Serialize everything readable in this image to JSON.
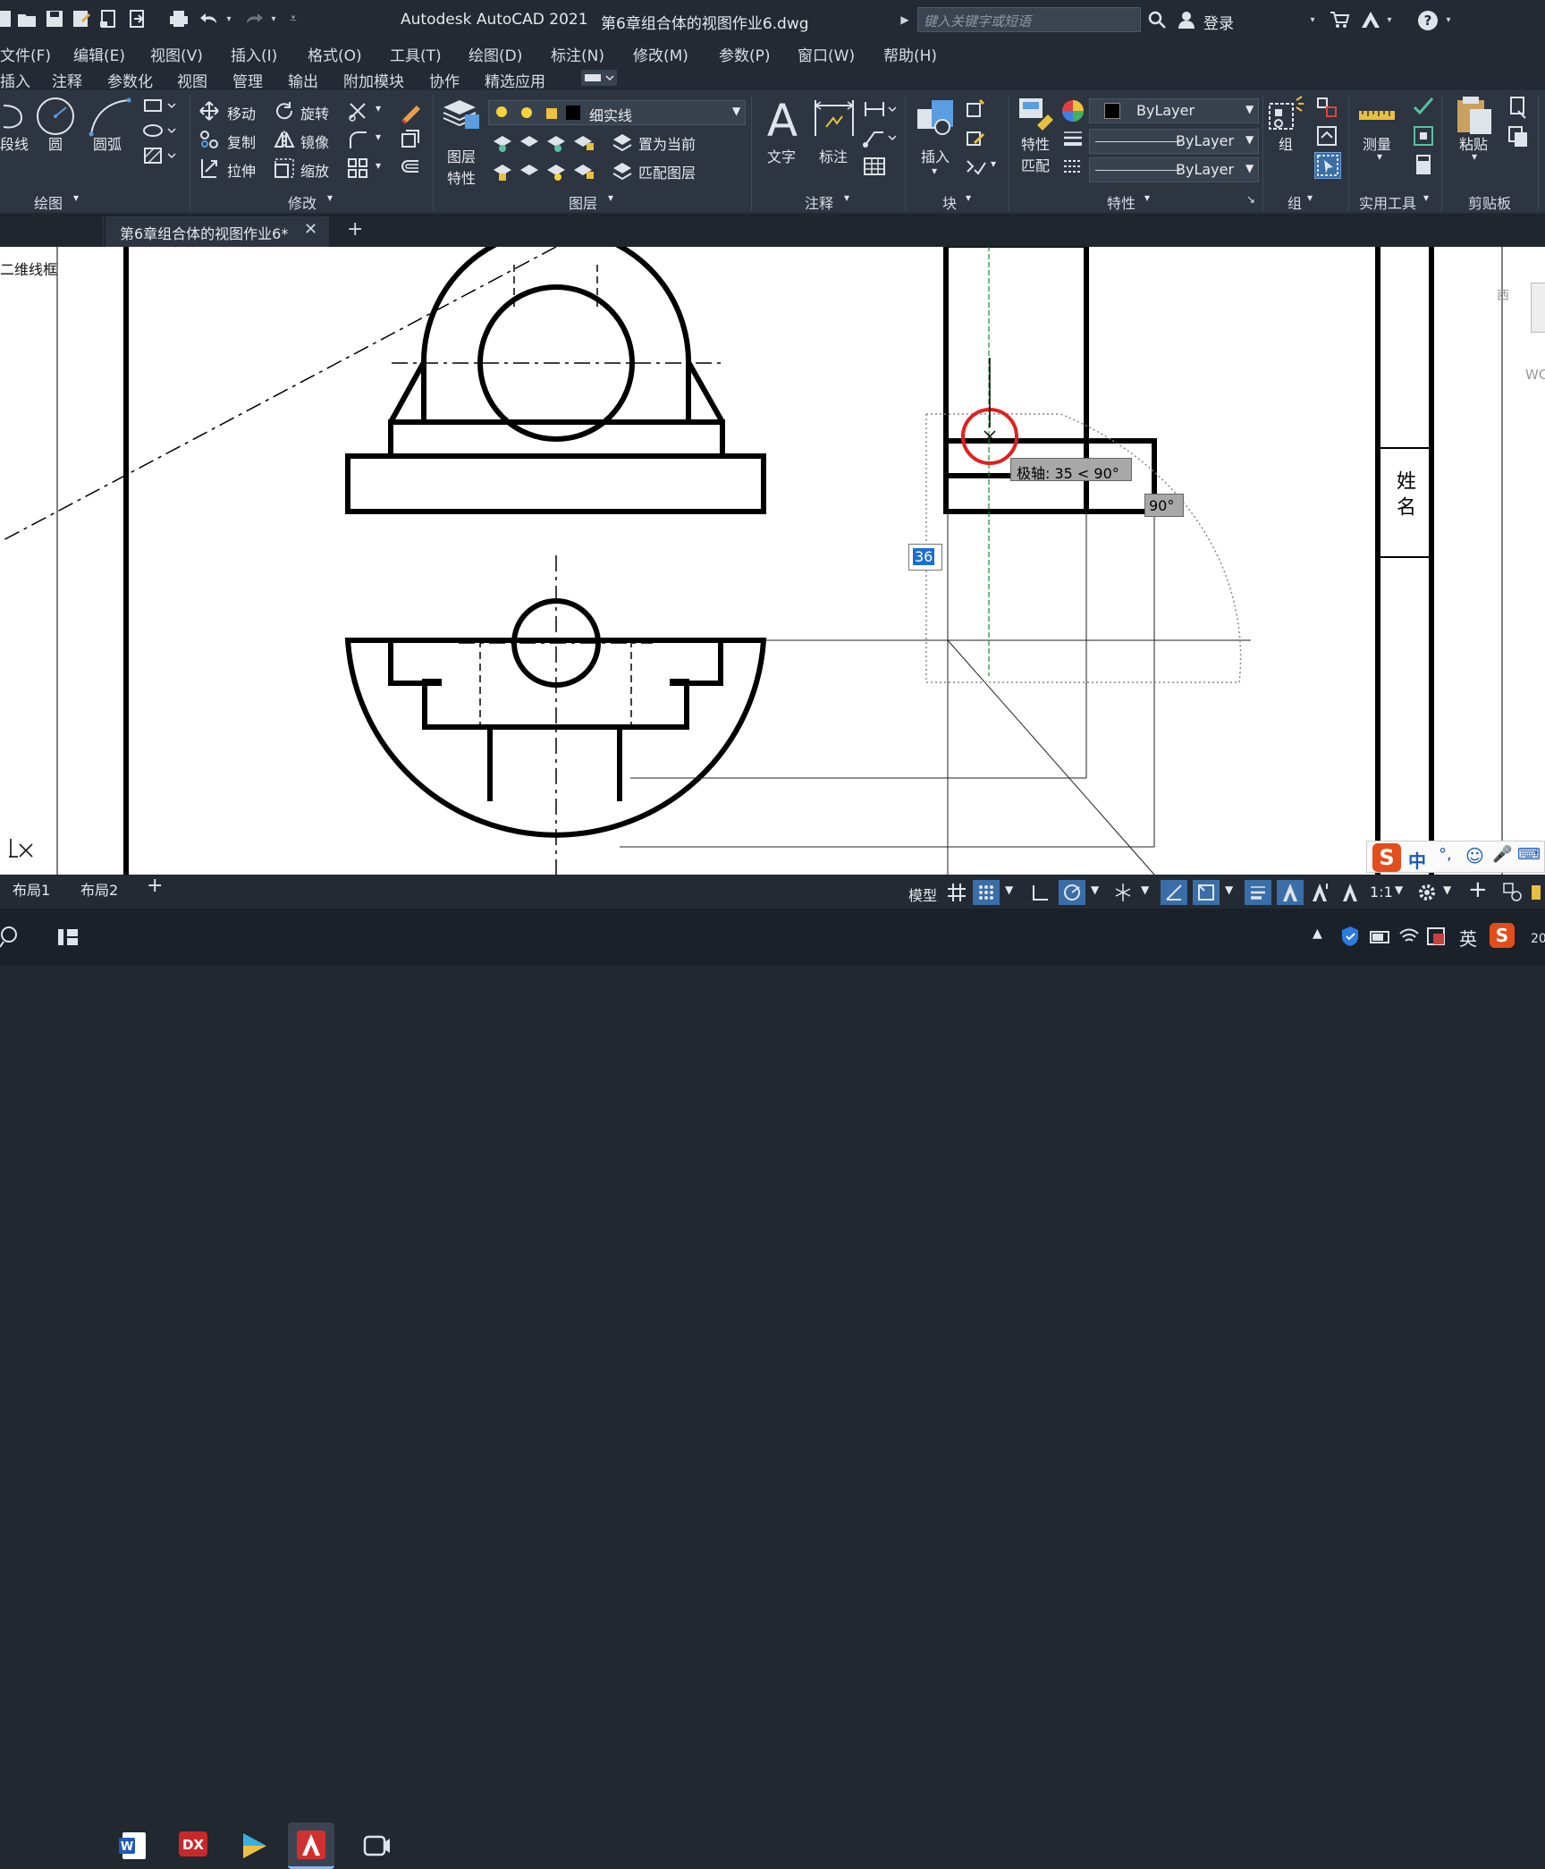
{
  "app": {
    "title": "Autodesk AutoCAD 2021",
    "filename": "第6章组合体的视图作业6.dwg",
    "search_placeholder": "键入关键字或短语",
    "login_label": "登录"
  },
  "menus": [
    "文件(F)",
    "编辑(E)",
    "视图(V)",
    "插入(I)",
    "格式(O)",
    "工具(T)",
    "绘图(D)",
    "标注(N)",
    "修改(M)",
    "参数(P)",
    "窗口(W)",
    "帮助(H)"
  ],
  "ribbon_tabs": [
    "插入",
    "注释",
    "参数化",
    "视图",
    "管理",
    "输出",
    "附加模块",
    "协作",
    "精选应用"
  ],
  "ribbon": {
    "draw": {
      "polyline": "段线",
      "circle": "圆",
      "arc": "圆弧",
      "title": "绘图"
    },
    "modify": {
      "move": "移动",
      "rotate": "旋转",
      "copy": "复制",
      "mirror": "镜像",
      "stretch": "拉伸",
      "scale": "缩放",
      "title": "修改"
    },
    "layers": {
      "layer_props": [
        "图层",
        "特性"
      ],
      "current_layer": "细实线",
      "set_current": "置为当前",
      "match_layer": "匹配图层",
      "title": "图层"
    },
    "annotation": {
      "text": "文字",
      "dimension": "标注",
      "title": "注释"
    },
    "block": {
      "insert": "插入",
      "title": "块"
    },
    "properties": {
      "match": [
        "特性",
        "匹配"
      ],
      "color": "ByLayer",
      "linetype": "ByLayer",
      "lineweight": "ByLayer",
      "title": "特性"
    },
    "groups": {
      "group": "组",
      "title": "组"
    },
    "utilities": {
      "measure": "测量",
      "title": "实用工具"
    },
    "clipboard": {
      "paste": "粘贴",
      "title": "剪贴板"
    }
  },
  "doc_tab": {
    "label": "第6章组合体的视图作业6*"
  },
  "viewport_label": "二维线框",
  "tooltip": {
    "polar": "极轴: 35 < 90°",
    "angle": "90°",
    "input_value": "36"
  },
  "title_block_text": "姓 名",
  "layout_tabs": [
    "布局1",
    "布局2"
  ],
  "status": {
    "model": "模型",
    "scale": "1:1"
  },
  "ime": {
    "label": "中"
  },
  "tray": {
    "lang": "英"
  },
  "right_panel": {
    "wcs": "WC"
  }
}
